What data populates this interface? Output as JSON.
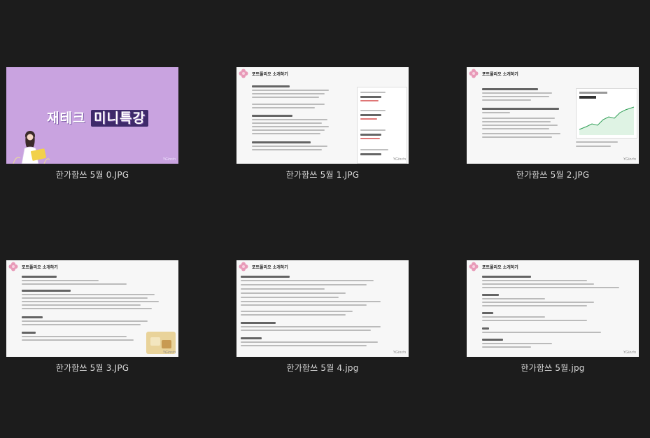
{
  "files": [
    {
      "name": "한가함쓰 5월 0.JPG",
      "slide": {
        "cover_title_a": "재테크 ",
        "cover_title_b": "미니특강"
      }
    },
    {
      "name": "한가함쓰 5월 1.JPG",
      "slide": {
        "header": "포트폴리오 소개하기"
      }
    },
    {
      "name": "한가함쓰 5월 2.JPG",
      "slide": {
        "header": "포트폴리오 소개하기"
      }
    },
    {
      "name": "한가함쓰 5월 3.JPG",
      "slide": {
        "header": "포트폴리오 소개하기"
      }
    },
    {
      "name": "한가함쓰 5월 4.jpg",
      "slide": {
        "header": "포트폴리오 소개하기"
      }
    },
    {
      "name": "한가함쓰 5월.jpg",
      "slide": {
        "header": "포트폴리오 소개하기"
      }
    }
  ],
  "colors": {
    "background": "#1c1c1c",
    "caption": "#d8d8d8",
    "cover": "#c9a3e0",
    "slide": "#f7f7f7",
    "flower": "#e89ab8"
  },
  "icons": [
    "image-thumbnail-icon",
    "flower-logo-icon"
  ]
}
